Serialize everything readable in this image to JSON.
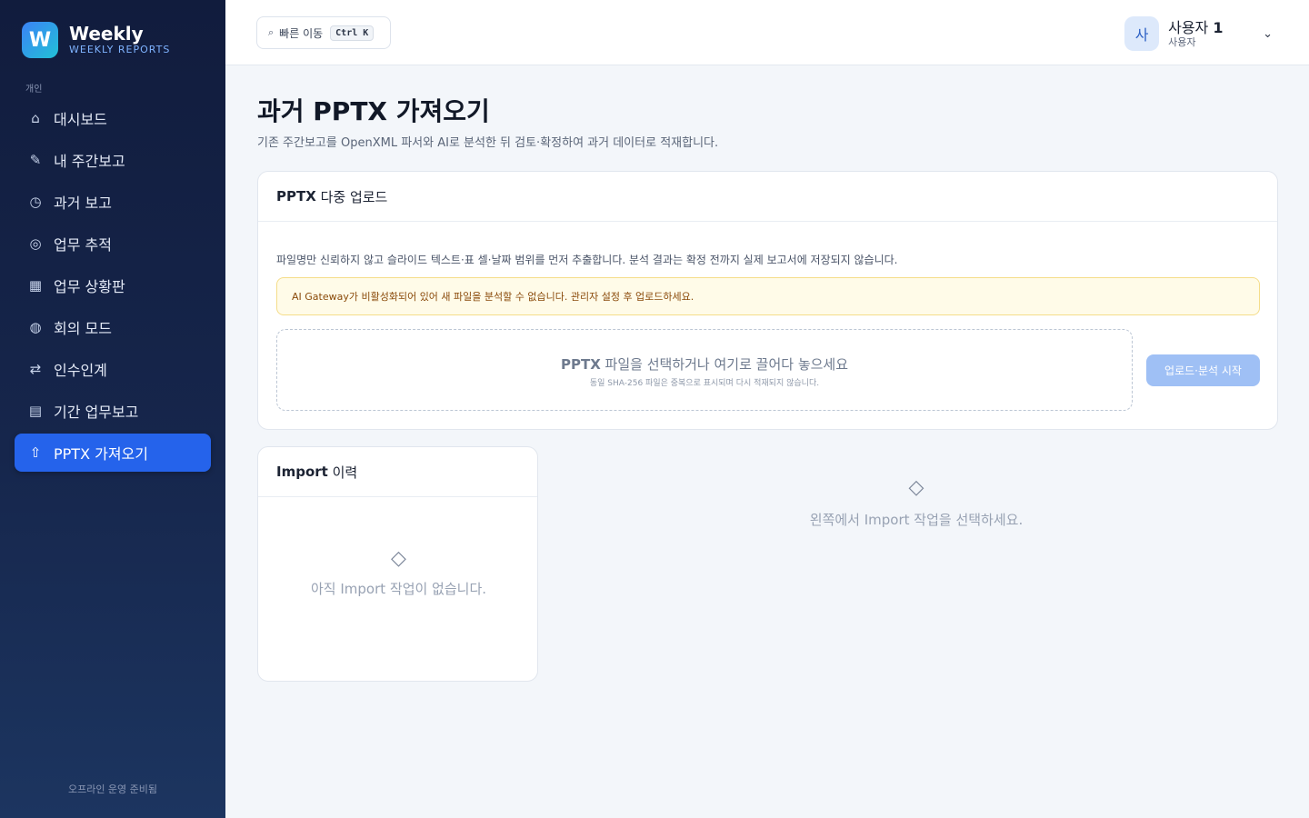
{
  "brand": {
    "logo_letter": "W",
    "name": "Weekly",
    "subtitle": "WEEKLY REPORTS"
  },
  "sidebar": {
    "section_label": "개인",
    "items": [
      {
        "label": "대시보드",
        "icon": "home-icon",
        "glyph": "⌂",
        "active": false
      },
      {
        "label": "내 주간보고",
        "icon": "pencil-icon",
        "glyph": "✎",
        "active": false
      },
      {
        "label": "과거 보고",
        "icon": "clock-icon",
        "glyph": "◷",
        "active": false
      },
      {
        "label": "업무 추적",
        "icon": "target-icon",
        "glyph": "◎",
        "active": false
      },
      {
        "label": "업무 상황판",
        "icon": "grid-icon",
        "glyph": "▦",
        "active": false
      },
      {
        "label": "회의 모드",
        "icon": "globe-icon",
        "glyph": "◍",
        "active": false
      },
      {
        "label": "인수인계",
        "icon": "swap-icon",
        "glyph": "⇄",
        "active": false
      },
      {
        "label": "기간 업무보고",
        "icon": "document-icon",
        "glyph": "▤",
        "active": false
      },
      {
        "label": "PPTX 가져오기",
        "icon": "upload-icon",
        "glyph": "⇧",
        "active": true
      }
    ],
    "footer": "오프라인 운영 준비됨"
  },
  "topbar": {
    "quick_jump": {
      "icon": "search-icon",
      "glyph": "⌕",
      "label": "빠른 이동",
      "shortcut": "Ctrl K"
    },
    "user": {
      "avatar": "사",
      "name": "사용자",
      "name_suffix": "1",
      "role": "사용자",
      "chevron": "⌄"
    }
  },
  "page": {
    "title_prefix": "과거",
    "title_bold": "PPTX",
    "title_suffix": "가져오기",
    "subtitle": "기존 주간보고를 OpenXML 파서와 AI로 분석한 뒤 검토·확정하여 과거 데이터로 적재합니다."
  },
  "upload_card": {
    "title_bold": "PPTX",
    "title_rest": "다중 업로드",
    "description": "파일명만 신뢰하지 않고 슬라이드 텍스트·표 셀·날짜 범위를 먼저 추출합니다. 분석 결과는 확정 전까지 실제 보고서에 저장되지 않습니다.",
    "warning": "AI Gateway가 비활성화되어 있어 새 파일을 분석할 수 없습니다. 관리자 설정 후 업로드하세요.",
    "dropzone_bold": "PPTX",
    "dropzone_title": "파일을 선택하거나 여기로 끌어다 놓으세요",
    "dropzone_note": "동일 SHA-256 파일은 중복으로 표시되며 다시 적재되지 않습니다.",
    "start_button": "업로드·분석 시작",
    "colors": {
      "warning_bg": "#fffbe8",
      "button_disabled": "#9fc0f5",
      "accent": "#2563eb"
    }
  },
  "import_card": {
    "title_bold": "Import",
    "title_rest": "이력",
    "empty_icon": "diamond-icon",
    "empty_glyph": "◇",
    "empty_message": "아직 Import 작업이 없습니다."
  },
  "detail_panel": {
    "empty_icon": "diamond-icon",
    "empty_glyph": "◇",
    "empty_message": "왼쪽에서 Import 작업을 선택하세요."
  }
}
